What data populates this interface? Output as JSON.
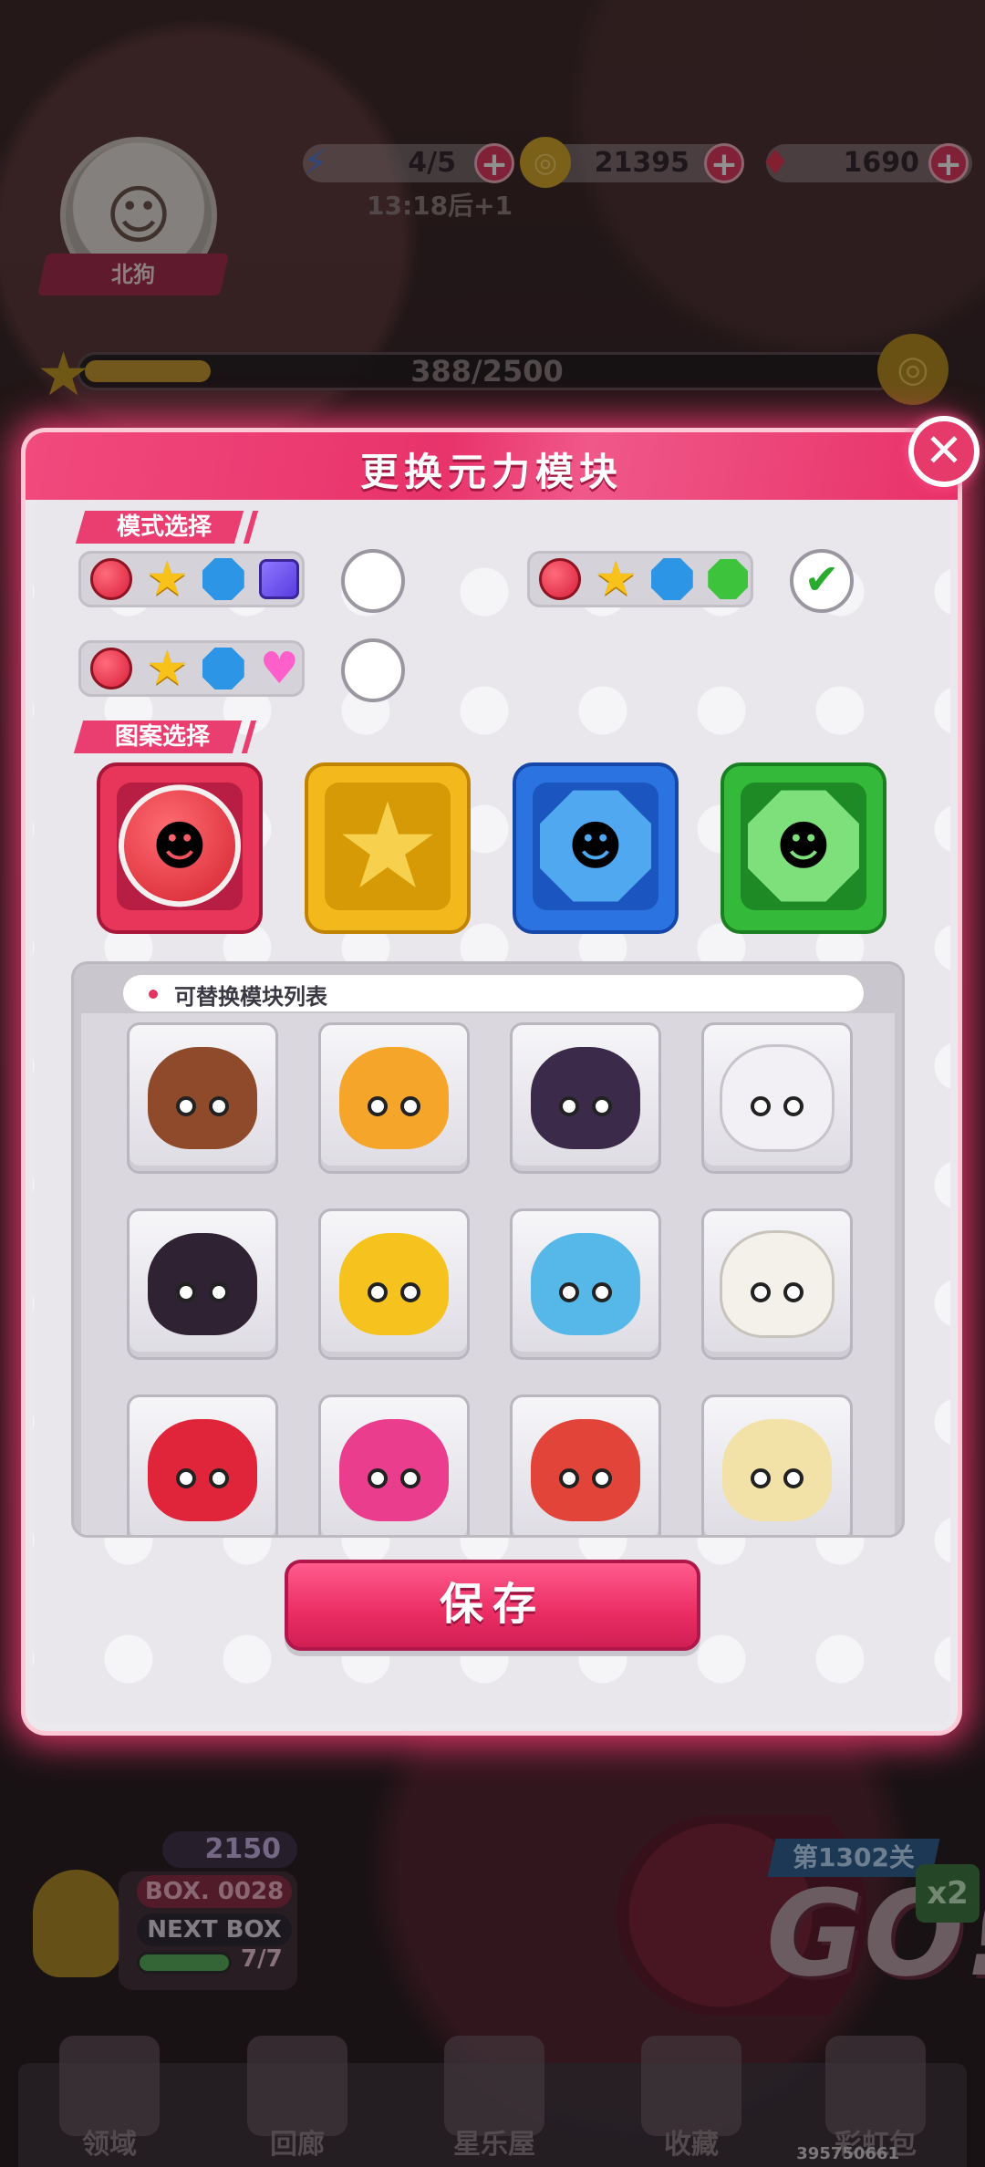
{
  "hud": {
    "player_name": "北狗",
    "energy": "4/5",
    "coins": "21395",
    "gems": "1690",
    "energy_timer": "13:18后+1",
    "exp_progress": "388/2500",
    "exp_fraction": 0.155
  },
  "modal": {
    "title": "更换元力模块",
    "close_icon": "close-icon",
    "mode_section_label": "模式选择",
    "mode_options": [
      {
        "shapes": [
          "red-circle",
          "yellow-star",
          "blue-hexagon",
          "purple-square"
        ],
        "selected": false
      },
      {
        "shapes": [
          "red-circle",
          "yellow-star",
          "blue-hexagon",
          "green-octagon"
        ],
        "selected": true
      },
      {
        "shapes": [
          "red-circle",
          "yellow-star",
          "blue-hexagon",
          "pink-heart"
        ],
        "selected": false
      }
    ],
    "pattern_section_label": "图案选择",
    "patterns": [
      {
        "name": "red-circle-pattern",
        "color": "#e8365a"
      },
      {
        "name": "yellow-star-pattern",
        "color": "#f2b81c"
      },
      {
        "name": "blue-octagon-pattern",
        "color": "#2b73e0"
      },
      {
        "name": "green-diamond-pattern",
        "color": "#35b93a"
      }
    ],
    "replace_list_label": "可替换模块列表",
    "module_tiles": [
      {
        "icon": "brown-spiky-blob-icon",
        "color": "#8e4a2a"
      },
      {
        "icon": "orange-spiky-blob-icon",
        "color": "#f4a52a"
      },
      {
        "icon": "purple-masked-blob-icon",
        "color": "#3b2a4a"
      },
      {
        "icon": "white-fluffy-blob-icon",
        "color": "#f2f0f4"
      },
      {
        "icon": "dark-star-blob-icon",
        "color": "#2e2233"
      },
      {
        "icon": "yellow-cap-blob-icon",
        "color": "#f6c21e"
      },
      {
        "icon": "blue-lemon-ghost-icon",
        "color": "#56b8e8"
      },
      {
        "icon": "white-goggle-blob-icon",
        "color": "#f3f1ea"
      },
      {
        "icon": "red-hooded-ghost-icon",
        "color": "#e0253a"
      },
      {
        "icon": "pink-ghost-icon",
        "color": "#ea3d8e"
      },
      {
        "icon": "red-ponytail-ghost-icon",
        "color": "#e2443a"
      },
      {
        "icon": "cream-spiky-blob-icon",
        "color": "#f2e2a8"
      }
    ],
    "save_label": "保存",
    "accent_color": "#ea3d70"
  },
  "bottom": {
    "gem_count": "2150",
    "box_label": "BOX. 0028",
    "next_box_label": "NEXT BOX",
    "box_progress": "7/7",
    "stage_label": "第1302关",
    "go_label": "GO!",
    "multiplier": "x2",
    "nav": [
      "领域",
      "回廊",
      "星乐屋",
      "收藏",
      "彩虹包"
    ],
    "uid": "395750661"
  }
}
